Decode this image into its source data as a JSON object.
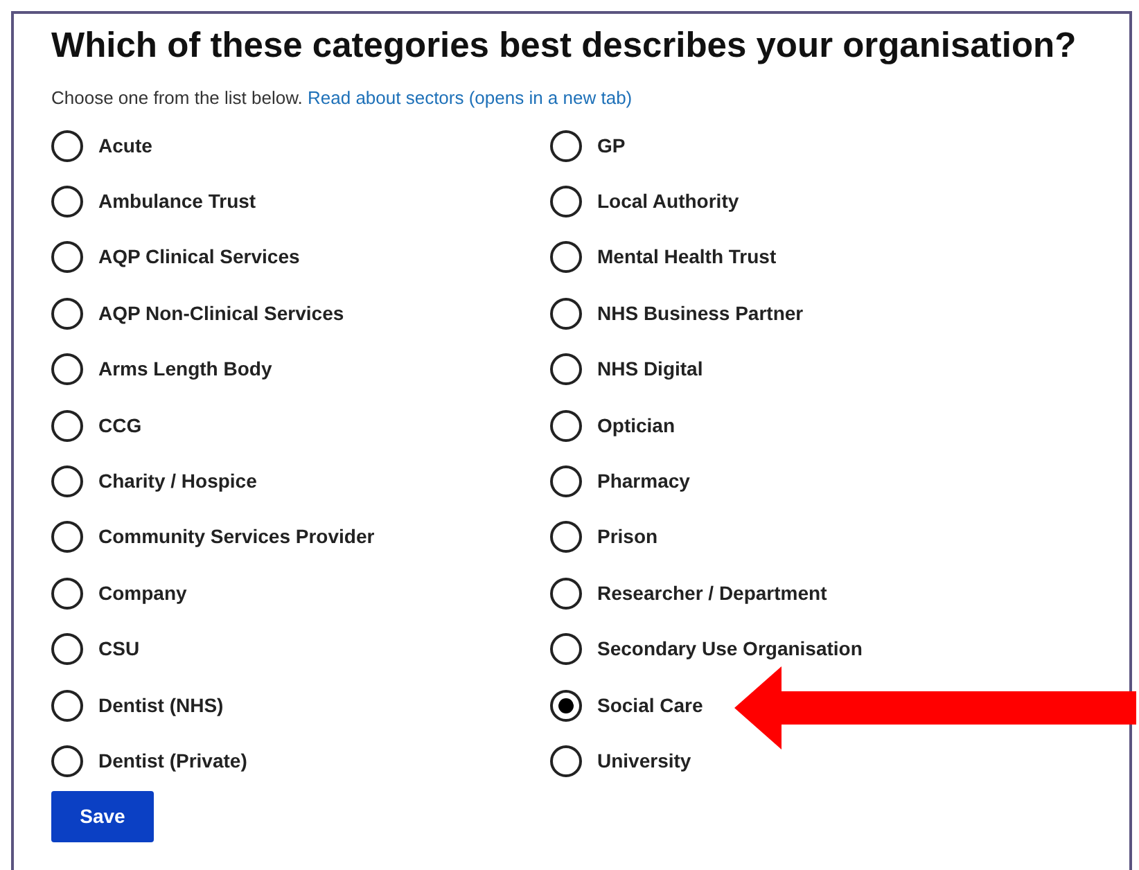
{
  "heading": "Which of these categories best describes your organisation?",
  "hint": "Choose one from the list below.",
  "hint_link": "Read about sectors (opens in a new tab)",
  "options": [
    {
      "label": "Acute",
      "selected": false
    },
    {
      "label": "Ambulance Trust",
      "selected": false
    },
    {
      "label": "AQP Clinical Services",
      "selected": false
    },
    {
      "label": "AQP Non-Clinical Services",
      "selected": false
    },
    {
      "label": "Arms Length Body",
      "selected": false
    },
    {
      "label": "CCG",
      "selected": false
    },
    {
      "label": "Charity / Hospice",
      "selected": false
    },
    {
      "label": "Community Services Provider",
      "selected": false
    },
    {
      "label": "Company",
      "selected": false
    },
    {
      "label": "CSU",
      "selected": false
    },
    {
      "label": "Dentist (NHS)",
      "selected": false
    },
    {
      "label": "Dentist (Private)",
      "selected": false
    },
    {
      "label": "GP",
      "selected": false
    },
    {
      "label": "Local Authority",
      "selected": false
    },
    {
      "label": "Mental Health Trust",
      "selected": false
    },
    {
      "label": "NHS Business Partner",
      "selected": false
    },
    {
      "label": "NHS Digital",
      "selected": false
    },
    {
      "label": "Optician",
      "selected": false
    },
    {
      "label": "Pharmacy",
      "selected": false
    },
    {
      "label": "Prison",
      "selected": false
    },
    {
      "label": "Researcher / Department",
      "selected": false
    },
    {
      "label": "Secondary Use Organisation",
      "selected": false
    },
    {
      "label": "Social Care",
      "selected": true
    },
    {
      "label": "University",
      "selected": false
    }
  ],
  "save_button": "Save"
}
